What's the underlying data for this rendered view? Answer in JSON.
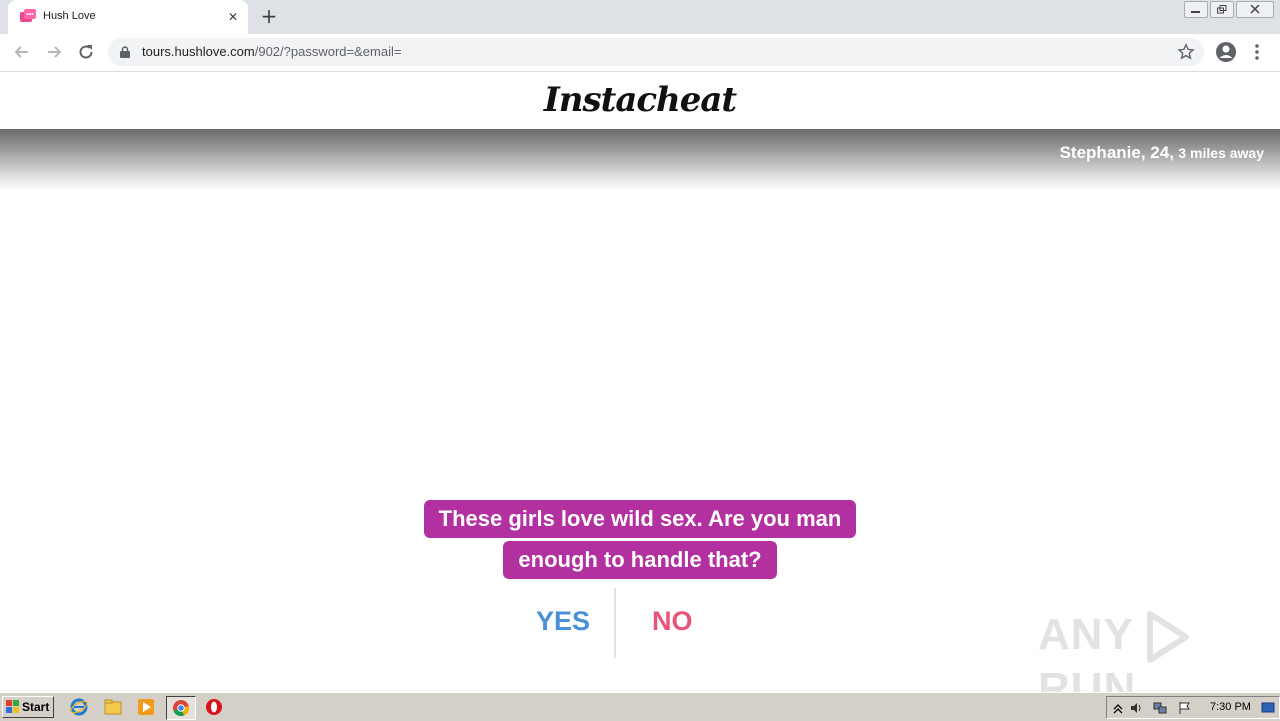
{
  "browser": {
    "tab_title": "Hush Love",
    "tab_close": "✕",
    "new_tab": "+",
    "url_host": "tours.hushlove.com",
    "url_rest": "/902/?password=&email="
  },
  "page": {
    "logo": "Instacheat",
    "profile_name": "Stephanie, 24,",
    "profile_distance": "3 miles away",
    "question_line1": "These girls love wild sex. Are you man",
    "question_line2": "enough to handle that?",
    "answer_yes": "YES",
    "answer_no": "NO",
    "watermark_left": "ANY",
    "watermark_right": "RUN"
  },
  "taskbar": {
    "start_label": "Start",
    "clock": "7:30 PM"
  },
  "colors": {
    "bubble": "#b2309f",
    "yes": "#4a90d9",
    "no": "#e8557a"
  },
  "icons": [
    "favicon-icon",
    "close-icon",
    "plus-icon",
    "minimize-icon",
    "restore-icon",
    "window-close-icon",
    "back-arrow-icon",
    "forward-arrow-icon",
    "reload-icon",
    "lock-icon",
    "star-icon",
    "account-icon",
    "more-vert-icon",
    "play-icon",
    "windows-flag-icon",
    "ie-icon",
    "folder-icon",
    "media-player-icon",
    "chrome-icon",
    "opera-icon",
    "arrow-up-icon",
    "speaker-icon",
    "network-icon",
    "flag-icon",
    "monitor-icon"
  ]
}
